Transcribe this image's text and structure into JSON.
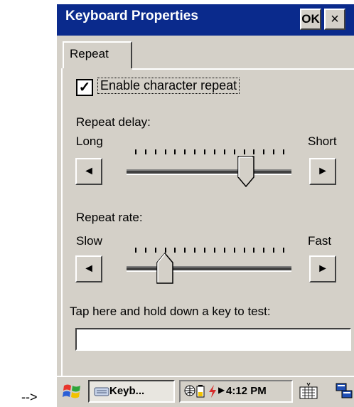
{
  "dialog": {
    "title": "Keyboard Properties",
    "ok_label": "OK",
    "close_label": "×",
    "tab_label": "Repeat",
    "enable_repeat": {
      "label": "Enable character repeat",
      "checked": true,
      "check_glyph": "✓"
    },
    "repeat_delay": {
      "label": "Repeat delay:",
      "min_label": "Long",
      "max_label": "Short",
      "value_fraction": 0.75
    },
    "repeat_rate": {
      "label": "Repeat rate:",
      "min_label": "Slow",
      "max_label": "Fast",
      "value_fraction": 0.2
    },
    "test": {
      "label": "Tap here and hold down a key to test:",
      "value": ""
    },
    "arrow_left_glyph": "◄",
    "arrow_right_glyph": "►"
  },
  "taskbar": {
    "task_label": "Keyb...",
    "tray_arrow": "▶",
    "clock": "4:12 PM"
  },
  "annotation": "-->",
  "colors": {
    "titlebar": "#0a2a8c",
    "dialog_bg": "#d4d0c8"
  }
}
